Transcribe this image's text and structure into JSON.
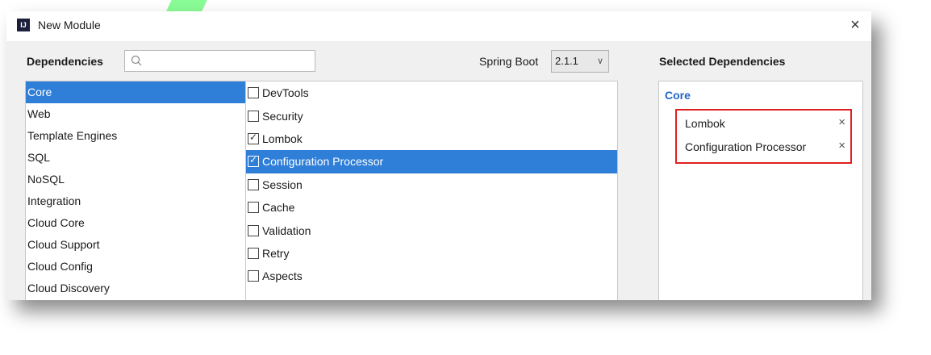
{
  "window": {
    "title": "New Module",
    "app_icon": "IJ",
    "close_icon": "×"
  },
  "dependencies": {
    "label": "Dependencies",
    "search_placeholder": "",
    "spring_boot_label": "Spring Boot",
    "spring_boot_version": "2.1.1",
    "chevron": "∨"
  },
  "categories": [
    "Core",
    "Web",
    "Template Engines",
    "SQL",
    "NoSQL",
    "Integration",
    "Cloud Core",
    "Cloud Support",
    "Cloud Config",
    "Cloud Discovery"
  ],
  "selected_category": "Core",
  "deps": [
    {
      "label": "DevTools",
      "checked": ""
    },
    {
      "label": "Security",
      "checked": ""
    },
    {
      "label": "Lombok",
      "checked": "✓"
    },
    {
      "label": "Configuration Processor",
      "checked": "✓"
    },
    {
      "label": "Session",
      "checked": ""
    },
    {
      "label": "Cache",
      "checked": ""
    },
    {
      "label": "Validation",
      "checked": ""
    },
    {
      "label": "Retry",
      "checked": ""
    },
    {
      "label": "Aspects",
      "checked": ""
    }
  ],
  "selected_deps": {
    "label": "Selected Dependencies",
    "group": "Core",
    "items": [
      "Lombok",
      "Configuration Processor"
    ],
    "remove_icon": "×"
  },
  "colors": {
    "selection": "#2f7ed8",
    "highlight_box": "#e02020",
    "group_heading": "#2264c6"
  }
}
